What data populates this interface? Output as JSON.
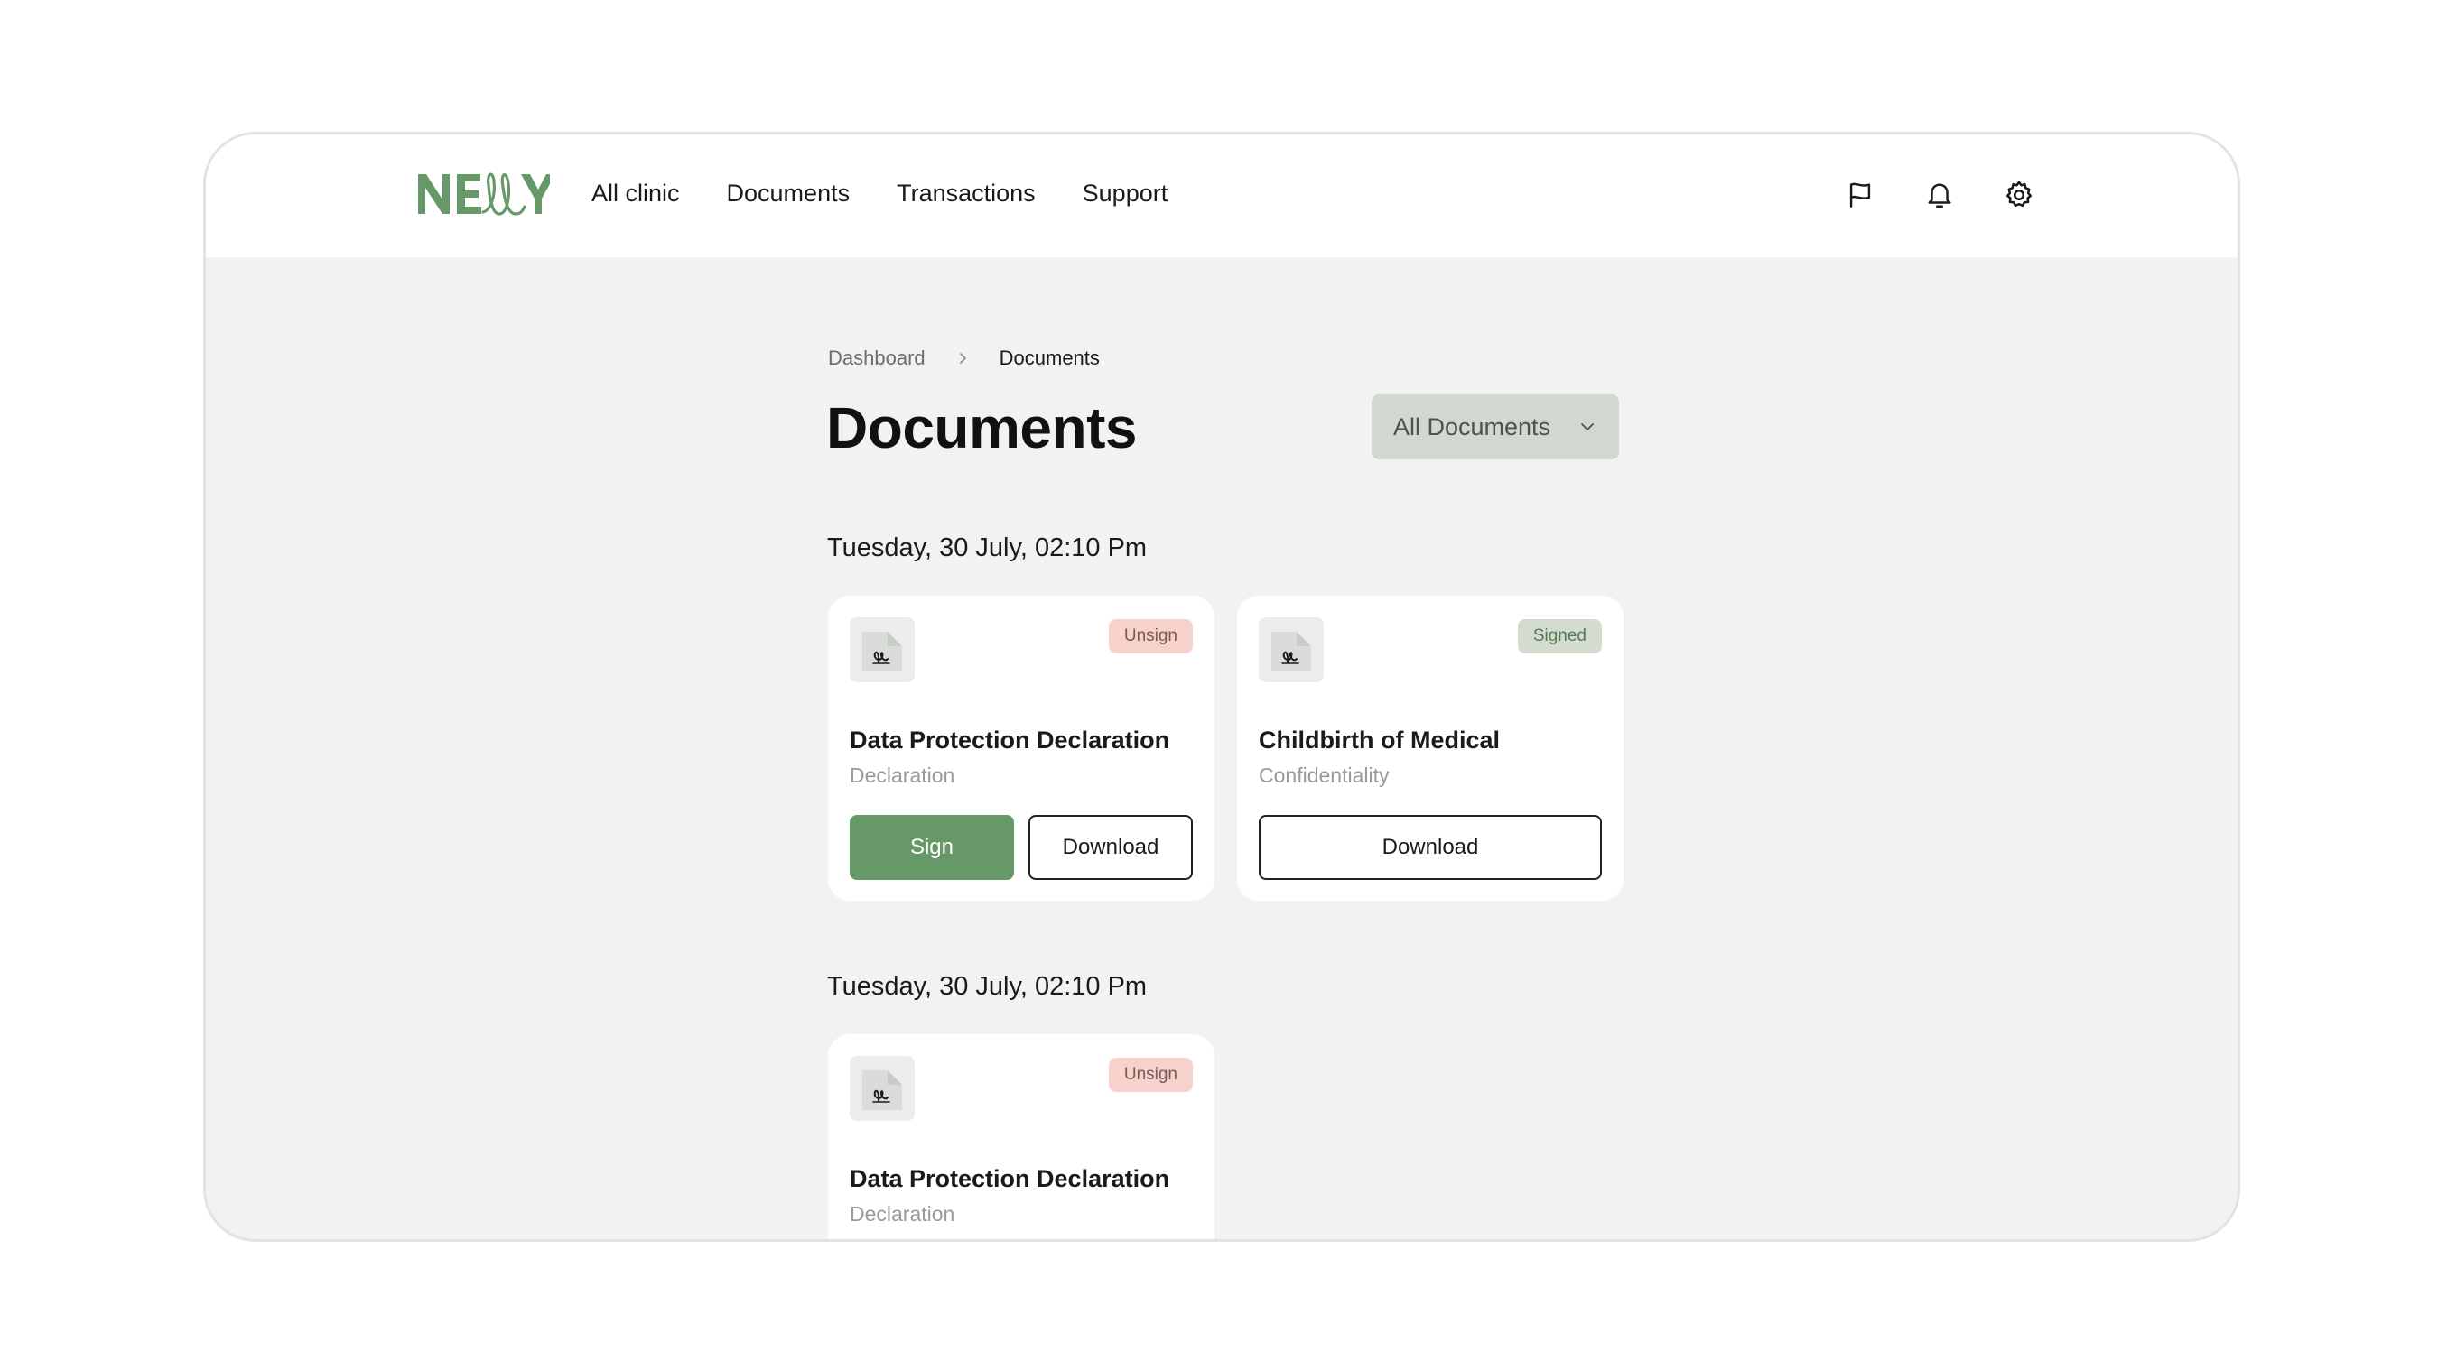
{
  "brand": {
    "name": "NELLY",
    "color": "#679867"
  },
  "nav": [
    "All clinic",
    "Documents",
    "Transactions",
    "Support"
  ],
  "header_icons": [
    "flag-icon",
    "bell-icon",
    "settings-icon"
  ],
  "breadcrumb": {
    "parent": "Dashboard",
    "current": "Documents"
  },
  "page": {
    "title": "Documents"
  },
  "filter": {
    "selected": "All Documents"
  },
  "groups": [
    {
      "date": "Tuesday, 30 July, 02:10 Pm",
      "documents": [
        {
          "title": "Data Protection Declaration",
          "subtitle": "Declaration",
          "status": "Unsign",
          "sign_label": "Sign",
          "download_label": "Download"
        },
        {
          "title": "Childbirth of Medical",
          "subtitle": "Confidentiality",
          "status": "Signed",
          "download_label": "Download"
        }
      ]
    },
    {
      "date": "Tuesday, 30 July, 02:10 Pm",
      "documents": [
        {
          "title": "Data Protection Declaration",
          "subtitle": "Declaration",
          "status": "Unsign"
        }
      ]
    }
  ],
  "colors": {
    "primary": "#679867",
    "background": "#f2f2f2",
    "unsign_badge": "#f7d1cc",
    "signed_badge": "#d3dccf",
    "filter_bg": "#d3d7d1"
  }
}
